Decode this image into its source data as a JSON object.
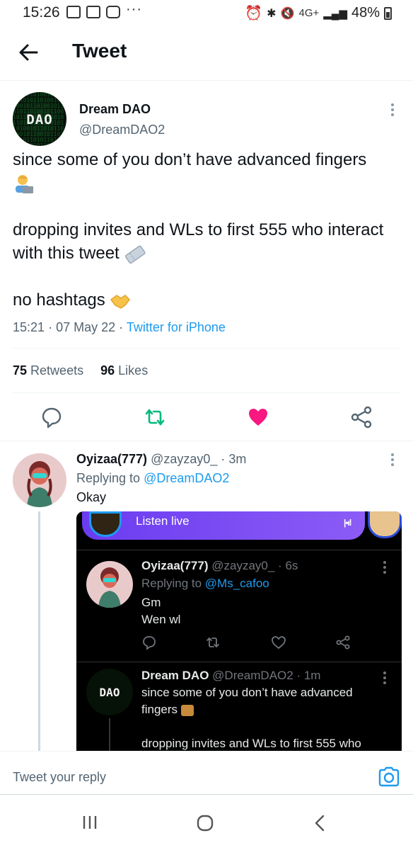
{
  "status_bar": {
    "time": "15:26",
    "left_icons": [
      "message-icon",
      "mail-icon",
      "instagram-icon"
    ],
    "more": "···",
    "network": "4G+",
    "battery": "48%"
  },
  "header": {
    "title": "Tweet"
  },
  "tweet": {
    "avatar_text": "DAO",
    "name": "Dream DAO",
    "handle": "@DreamDAO2",
    "paragraph1": "since some of you don’t have advanced fingers",
    "paragraph2": "dropping invites and WLs to first 555 who interact with this tweet",
    "paragraph3": "no hashtags",
    "time": "15:21",
    "date": "07 May 22",
    "source": "Twitter for iPhone",
    "retweets_count": "75",
    "retweets_label": "Retweets",
    "likes_count": "96",
    "likes_label": "Likes",
    "liked": true,
    "colors": {
      "link": "#1d9bf0",
      "retweet": "#00ba7c",
      "like": "#f91880"
    }
  },
  "reply": {
    "name": "Oyizaa(777)",
    "handle": "@zayzay0_",
    "age": "3m",
    "replying_label": "Replying to",
    "replying_to": "@DreamDAO2",
    "text": "Okay"
  },
  "embed": {
    "live_label": "Listen live",
    "tweet1": {
      "name": "Oyizaa(777)",
      "handle": "@zayzay0_",
      "age": "6s",
      "replying_label": "Replying to",
      "replying_to": "@Ms_cafoo",
      "line1": "Gm",
      "line2": "Wen wl"
    },
    "tweet2": {
      "avatar_text": "DAO",
      "name": "Dream DAO",
      "handle": "@DreamDAO2",
      "age": "1m",
      "line1": "since some of you don’t have advanced",
      "line2": "fingers",
      "line3": "dropping invites and WLs to first 555 who"
    }
  },
  "compose": {
    "placeholder": "Tweet your reply"
  }
}
